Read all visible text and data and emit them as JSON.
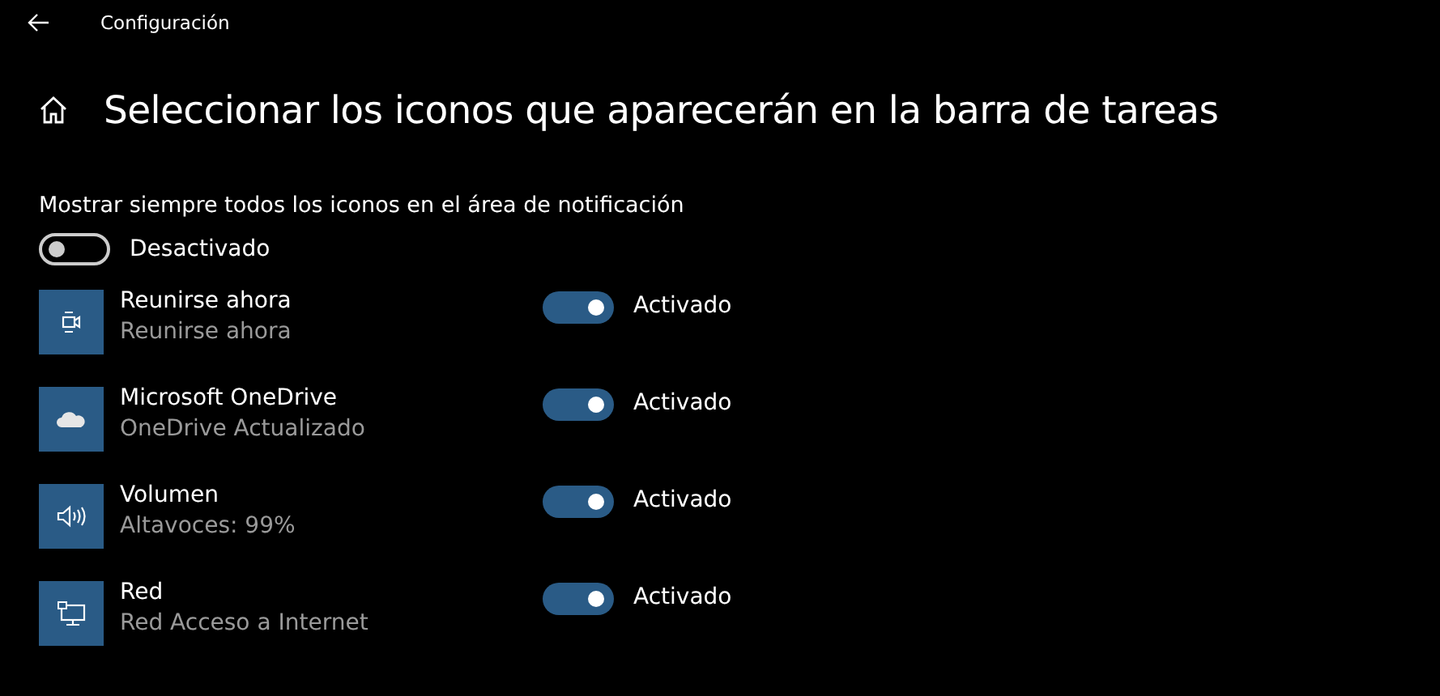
{
  "window": {
    "title": "Configuración"
  },
  "heading": "Seleccionar los iconos que aparecerán en la barra de tareas",
  "always_show": {
    "label": "Mostrar siempre todos los iconos en el área de notificación",
    "on": false,
    "state_text": "Desactivado"
  },
  "apps": [
    {
      "kind": "camera",
      "name": "Reunirse ahora",
      "status": "Reunirse ahora",
      "on": true,
      "state_text": "Activado"
    },
    {
      "kind": "cloud",
      "name": "Microsoft OneDrive",
      "status": "OneDrive Actualizado",
      "on": true,
      "state_text": "Activado"
    },
    {
      "kind": "speaker",
      "name": "Volumen",
      "status": "Altavoces: 99%",
      "on": true,
      "state_text": "Activado"
    },
    {
      "kind": "network",
      "name": "Red",
      "status": "Red Acceso a Internet",
      "on": true,
      "state_text": "Activado"
    }
  ]
}
